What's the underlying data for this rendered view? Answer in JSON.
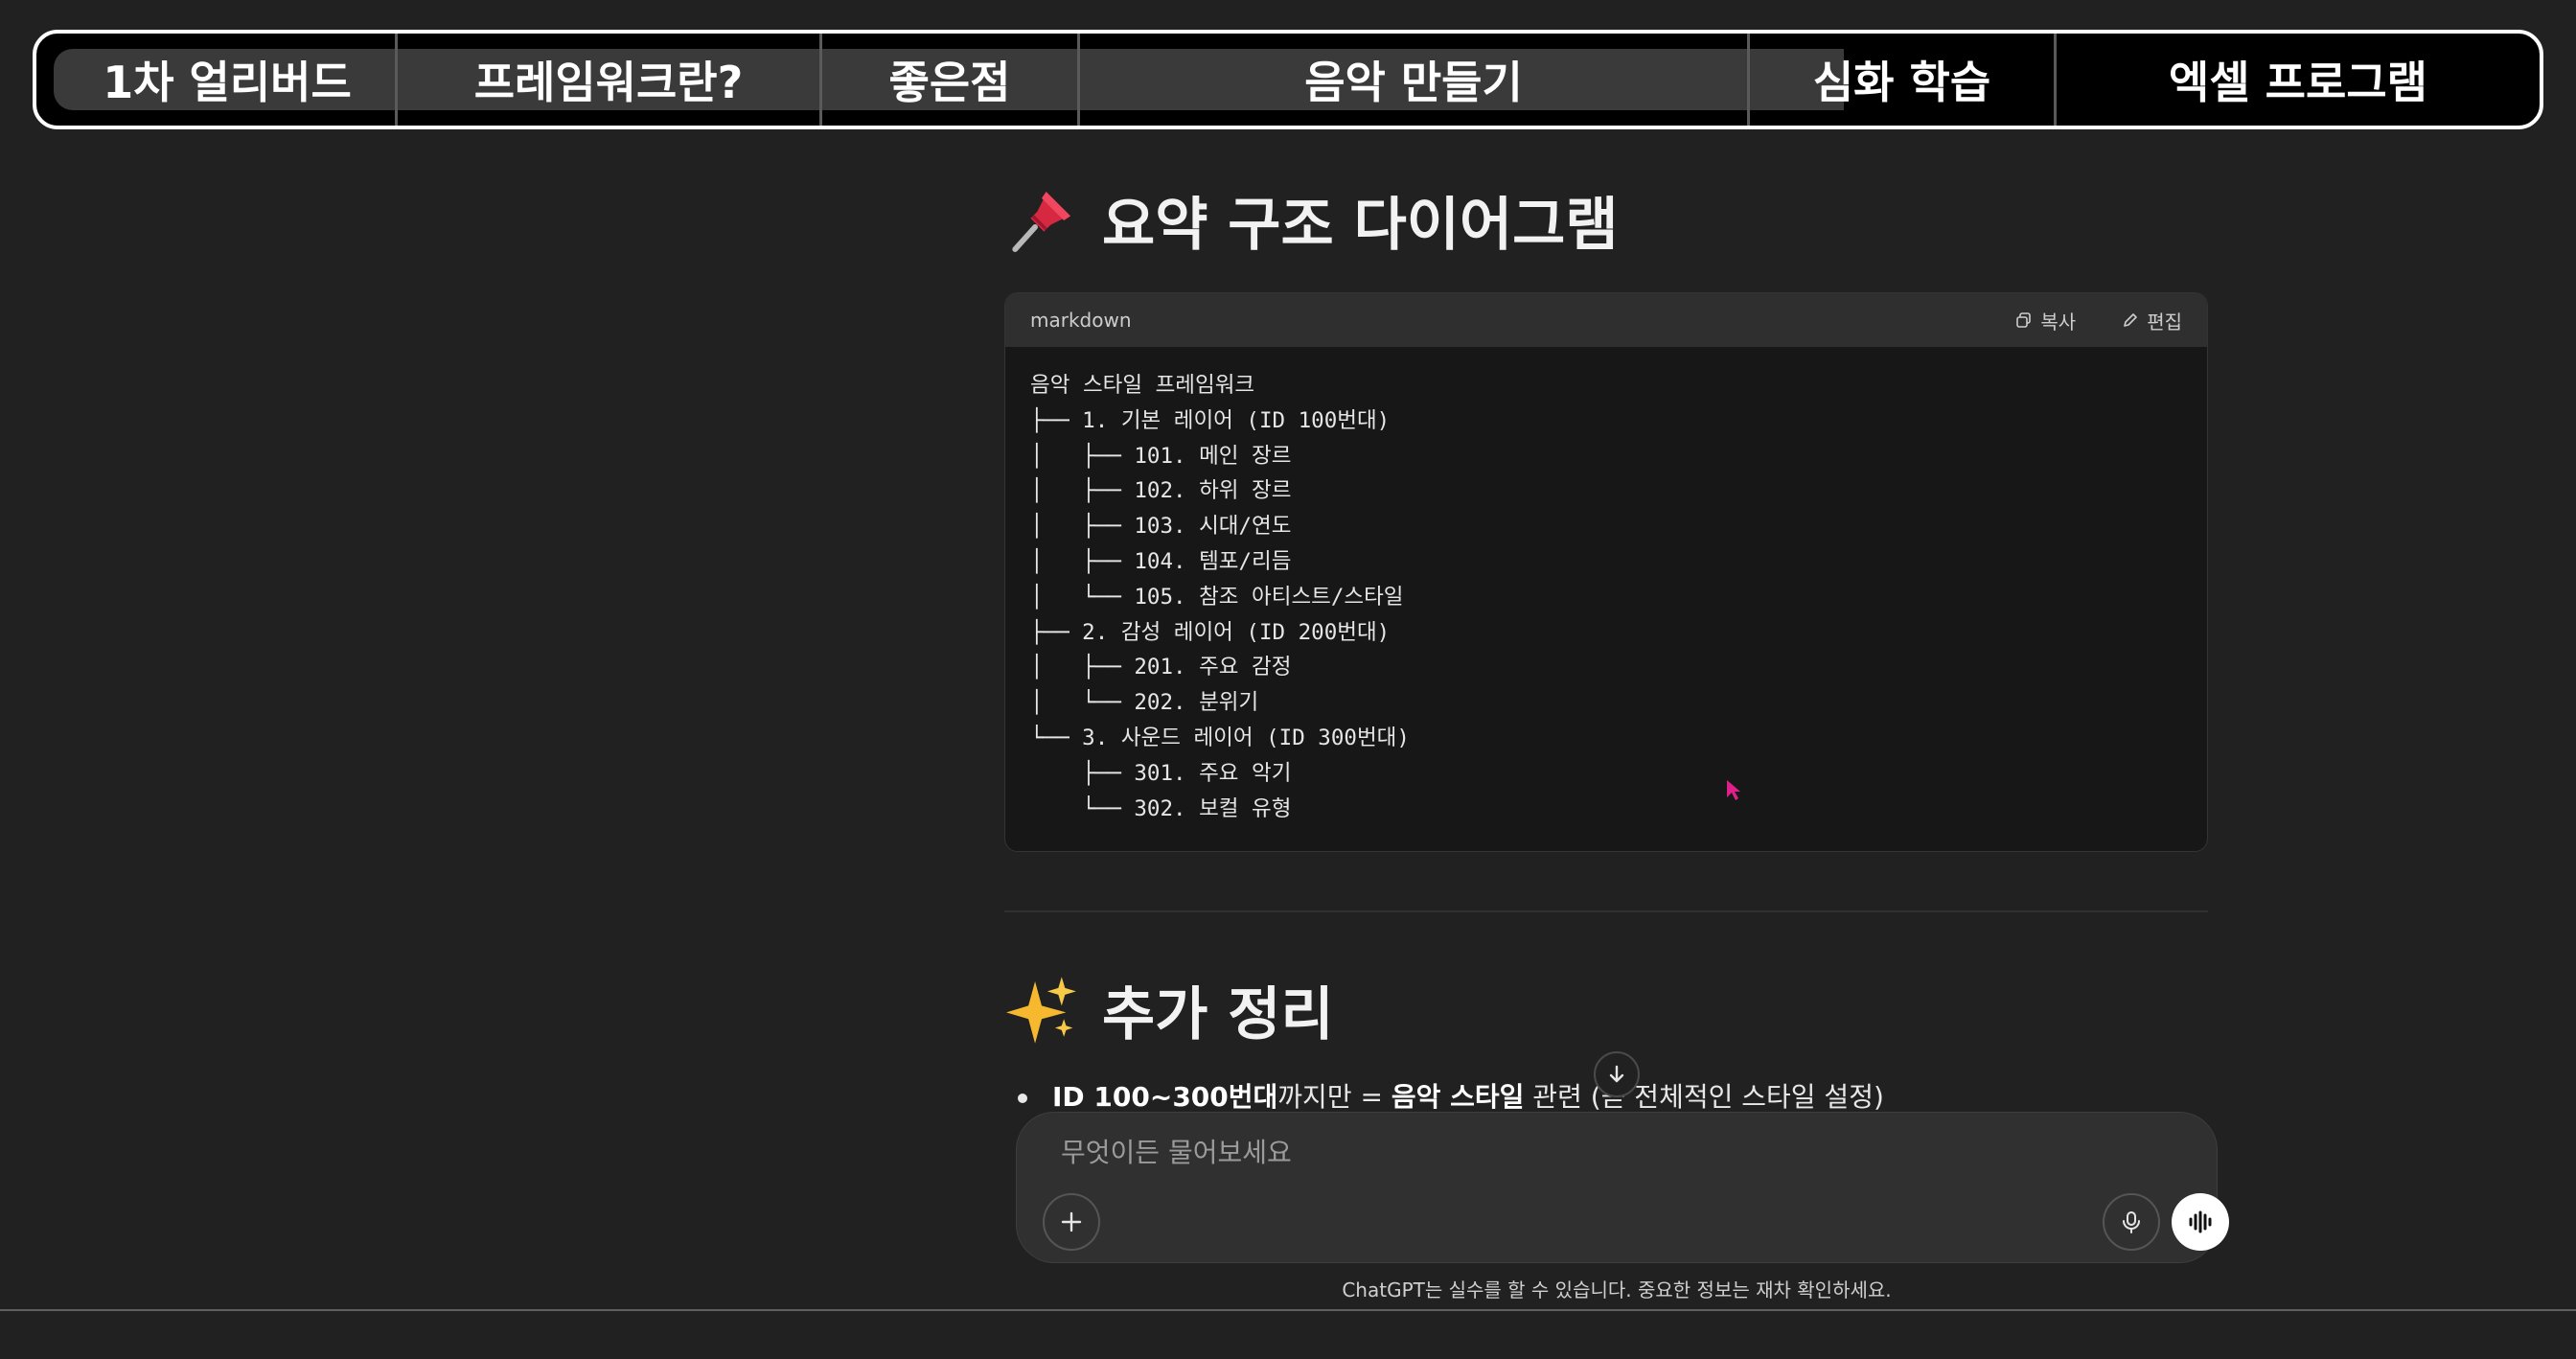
{
  "topbar": {
    "progress_fraction": 0.72,
    "tabs": [
      {
        "label": "1차 얼리버드"
      },
      {
        "label": "프레임워크란?"
      },
      {
        "label": "좋은점"
      },
      {
        "label": "음악 만들기"
      },
      {
        "label": "심화 학습"
      },
      {
        "label": "엑셀 프로그램"
      }
    ]
  },
  "section1": {
    "emoji": "pushpin-icon",
    "title": "요약 구조 다이어그램"
  },
  "codeblock": {
    "language": "markdown",
    "copy_label": "복사",
    "edit_label": "편집",
    "lines": [
      "음악 스타일 프레임워크",
      "├── 1. 기본 레이어 (ID 100번대)",
      "│   ├── 101. 메인 장르",
      "│   ├── 102. 하위 장르",
      "│   ├── 103. 시대/연도",
      "│   ├── 104. 템포/리듬",
      "│   └── 105. 참조 아티스트/스타일",
      "├── 2. 감성 레이어 (ID 200번대)",
      "│   ├── 201. 주요 감정",
      "│   └── 202. 분위기",
      "└── 3. 사운드 레이어 (ID 300번대)",
      "    ├── 301. 주요 악기",
      "    └── 302. 보컬 유형"
    ]
  },
  "section2": {
    "emoji": "sparkles-icon",
    "title": "추가 정리"
  },
  "bullet": {
    "part1_bold": "ID 100~300번대",
    "part2": "까지만 = ",
    "part3_bold": "음악 스타일",
    "part4": " 관련 (곧 전체적인 스타일 설정)"
  },
  "composer": {
    "placeholder": "무엇이든 물어보세요"
  },
  "footer": {
    "disclaimer": "ChatGPT는 실수를 할 수 있습니다. 중요한 정보는 재차 확인하세요."
  },
  "colors": {
    "background": "#212121",
    "topbar_bg": "#000000",
    "progress": "#3a3a3a",
    "code_bg": "#171717",
    "code_header": "#2f2f2f",
    "cursor": "#e0208a"
  }
}
